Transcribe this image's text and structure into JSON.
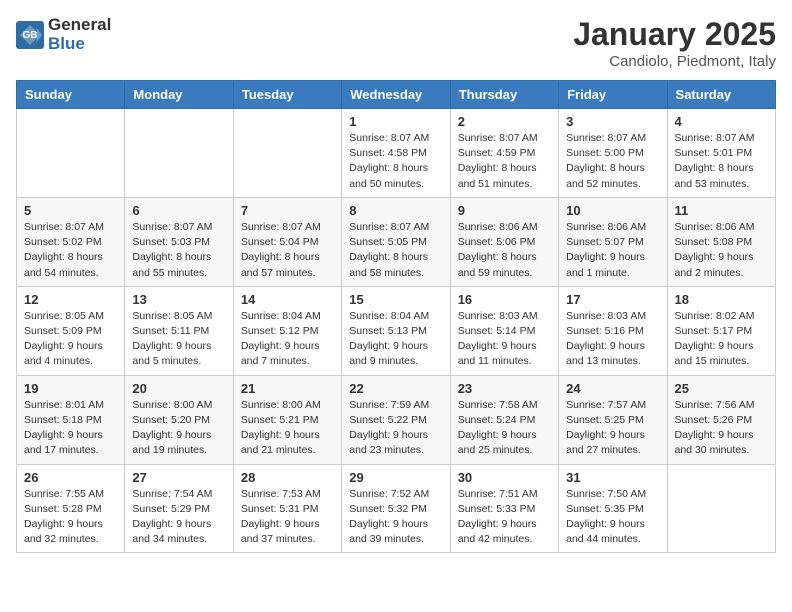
{
  "header": {
    "logo_general": "General",
    "logo_blue": "Blue",
    "month_title": "January 2025",
    "location": "Candiolo, Piedmont, Italy"
  },
  "days_of_week": [
    "Sunday",
    "Monday",
    "Tuesday",
    "Wednesday",
    "Thursday",
    "Friday",
    "Saturday"
  ],
  "weeks": [
    [
      {
        "day": "",
        "info": ""
      },
      {
        "day": "",
        "info": ""
      },
      {
        "day": "",
        "info": ""
      },
      {
        "day": "1",
        "info": "Sunrise: 8:07 AM\nSunset: 4:58 PM\nDaylight: 8 hours\nand 50 minutes."
      },
      {
        "day": "2",
        "info": "Sunrise: 8:07 AM\nSunset: 4:59 PM\nDaylight: 8 hours\nand 51 minutes."
      },
      {
        "day": "3",
        "info": "Sunrise: 8:07 AM\nSunset: 5:00 PM\nDaylight: 8 hours\nand 52 minutes."
      },
      {
        "day": "4",
        "info": "Sunrise: 8:07 AM\nSunset: 5:01 PM\nDaylight: 8 hours\nand 53 minutes."
      }
    ],
    [
      {
        "day": "5",
        "info": "Sunrise: 8:07 AM\nSunset: 5:02 PM\nDaylight: 8 hours\nand 54 minutes."
      },
      {
        "day": "6",
        "info": "Sunrise: 8:07 AM\nSunset: 5:03 PM\nDaylight: 8 hours\nand 55 minutes."
      },
      {
        "day": "7",
        "info": "Sunrise: 8:07 AM\nSunset: 5:04 PM\nDaylight: 8 hours\nand 57 minutes."
      },
      {
        "day": "8",
        "info": "Sunrise: 8:07 AM\nSunset: 5:05 PM\nDaylight: 8 hours\nand 58 minutes."
      },
      {
        "day": "9",
        "info": "Sunrise: 8:06 AM\nSunset: 5:06 PM\nDaylight: 8 hours\nand 59 minutes."
      },
      {
        "day": "10",
        "info": "Sunrise: 8:06 AM\nSunset: 5:07 PM\nDaylight: 9 hours\nand 1 minute."
      },
      {
        "day": "11",
        "info": "Sunrise: 8:06 AM\nSunset: 5:08 PM\nDaylight: 9 hours\nand 2 minutes."
      }
    ],
    [
      {
        "day": "12",
        "info": "Sunrise: 8:05 AM\nSunset: 5:09 PM\nDaylight: 9 hours\nand 4 minutes."
      },
      {
        "day": "13",
        "info": "Sunrise: 8:05 AM\nSunset: 5:11 PM\nDaylight: 9 hours\nand 5 minutes."
      },
      {
        "day": "14",
        "info": "Sunrise: 8:04 AM\nSunset: 5:12 PM\nDaylight: 9 hours\nand 7 minutes."
      },
      {
        "day": "15",
        "info": "Sunrise: 8:04 AM\nSunset: 5:13 PM\nDaylight: 9 hours\nand 9 minutes."
      },
      {
        "day": "16",
        "info": "Sunrise: 8:03 AM\nSunset: 5:14 PM\nDaylight: 9 hours\nand 11 minutes."
      },
      {
        "day": "17",
        "info": "Sunrise: 8:03 AM\nSunset: 5:16 PM\nDaylight: 9 hours\nand 13 minutes."
      },
      {
        "day": "18",
        "info": "Sunrise: 8:02 AM\nSunset: 5:17 PM\nDaylight: 9 hours\nand 15 minutes."
      }
    ],
    [
      {
        "day": "19",
        "info": "Sunrise: 8:01 AM\nSunset: 5:18 PM\nDaylight: 9 hours\nand 17 minutes."
      },
      {
        "day": "20",
        "info": "Sunrise: 8:00 AM\nSunset: 5:20 PM\nDaylight: 9 hours\nand 19 minutes."
      },
      {
        "day": "21",
        "info": "Sunrise: 8:00 AM\nSunset: 5:21 PM\nDaylight: 9 hours\nand 21 minutes."
      },
      {
        "day": "22",
        "info": "Sunrise: 7:59 AM\nSunset: 5:22 PM\nDaylight: 9 hours\nand 23 minutes."
      },
      {
        "day": "23",
        "info": "Sunrise: 7:58 AM\nSunset: 5:24 PM\nDaylight: 9 hours\nand 25 minutes."
      },
      {
        "day": "24",
        "info": "Sunrise: 7:57 AM\nSunset: 5:25 PM\nDaylight: 9 hours\nand 27 minutes."
      },
      {
        "day": "25",
        "info": "Sunrise: 7:56 AM\nSunset: 5:26 PM\nDaylight: 9 hours\nand 30 minutes."
      }
    ],
    [
      {
        "day": "26",
        "info": "Sunrise: 7:55 AM\nSunset: 5:28 PM\nDaylight: 9 hours\nand 32 minutes."
      },
      {
        "day": "27",
        "info": "Sunrise: 7:54 AM\nSunset: 5:29 PM\nDaylight: 9 hours\nand 34 minutes."
      },
      {
        "day": "28",
        "info": "Sunrise: 7:53 AM\nSunset: 5:31 PM\nDaylight: 9 hours\nand 37 minutes."
      },
      {
        "day": "29",
        "info": "Sunrise: 7:52 AM\nSunset: 5:32 PM\nDaylight: 9 hours\nand 39 minutes."
      },
      {
        "day": "30",
        "info": "Sunrise: 7:51 AM\nSunset: 5:33 PM\nDaylight: 9 hours\nand 42 minutes."
      },
      {
        "day": "31",
        "info": "Sunrise: 7:50 AM\nSunset: 5:35 PM\nDaylight: 9 hours\nand 44 minutes."
      },
      {
        "day": "",
        "info": ""
      }
    ]
  ]
}
